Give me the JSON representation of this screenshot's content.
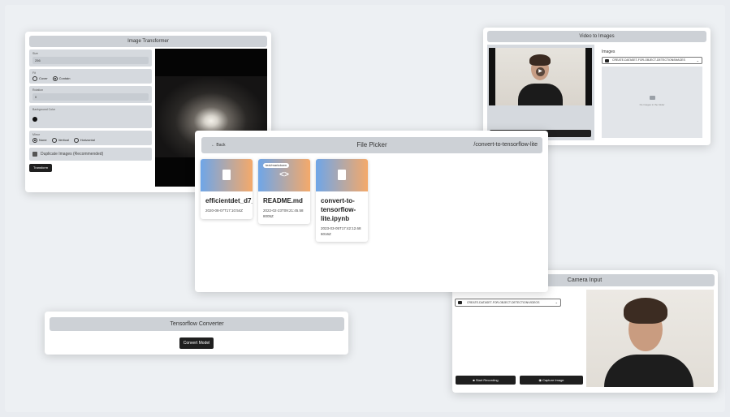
{
  "image_transformer": {
    "title": "Image Transformer",
    "size_label": "Size",
    "size_value": "256",
    "fit_label": "Fit",
    "fit_options": [
      "Cover",
      "Contain"
    ],
    "rotation_label": "Rotation",
    "rotation_value": "0",
    "background_label": "Background Color",
    "mirror_label": "Mirror",
    "mirror_options": [
      "None",
      "Vertical",
      "Horizontal"
    ],
    "duplicate_label": "Duplicate Images (Recommended)",
    "transform_button": "Transform"
  },
  "video_to_images": {
    "title": "Video to Images",
    "images_label": "Images",
    "folder_select": "CREATE-DATASET-FOR-OBJECT-DETECTION/IMAGES",
    "empty_message": "No images in the folder"
  },
  "file_picker": {
    "back_label": "Back",
    "title": "File Picker",
    "path": "/convert-to-tensorflow-lite",
    "files": [
      {
        "name": "efficientdet_d7_1",
        "date": "2020-08-07T17:10:54Z",
        "tag": ""
      },
      {
        "name": "README.md",
        "date": "2022-02-23T09:21:45.588005Z",
        "tag": "text/markdown"
      },
      {
        "name": "convert-to-tensorflow-lite.ipynb",
        "date": "2023-03-05T17:42:12.686016Z",
        "tag": ""
      }
    ]
  },
  "camera_input": {
    "title": "Camera Input",
    "hint": "Select a folder to save your recordings",
    "folder_select": "CREATE-DATASET-FOR-OBJECT-DETECTION/VIDEOS",
    "start_recording": "Start Recording",
    "capture_image": "Capture Image"
  },
  "tensorflow_converter": {
    "title": "Tensorflow Converter",
    "convert_button": "Convert Model"
  }
}
